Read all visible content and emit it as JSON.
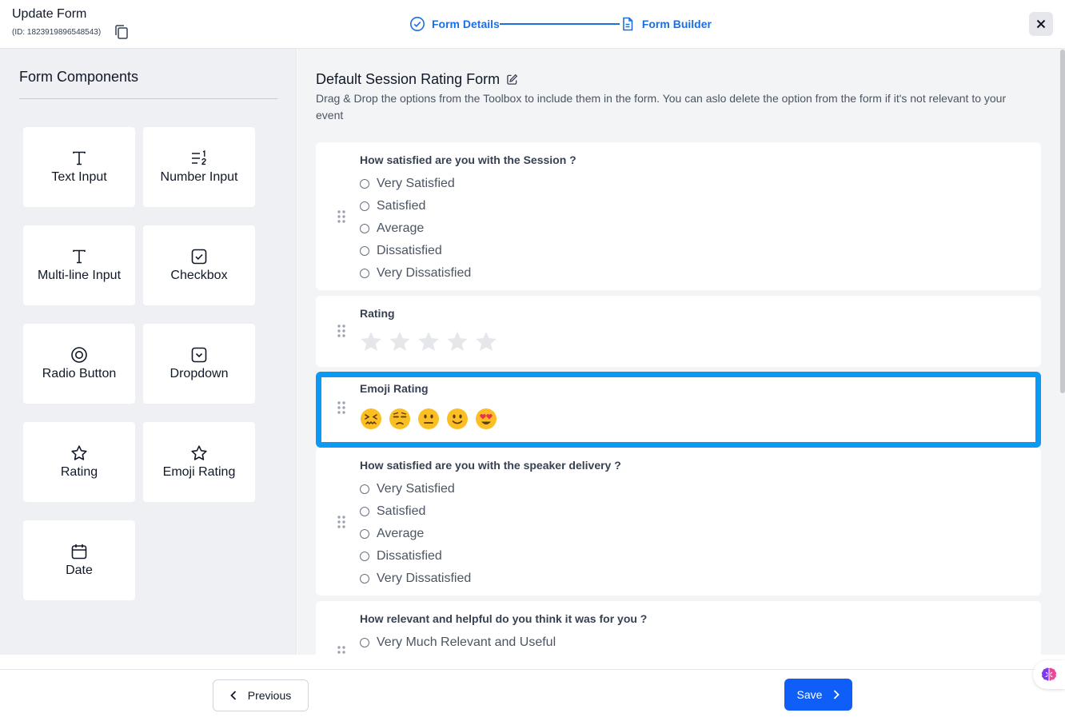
{
  "header": {
    "title": "Update Form",
    "form_id": "(ID: 1823919896548543)",
    "steps": [
      {
        "label": "Form Details",
        "icon": "check-circle-icon"
      },
      {
        "label": "Form Builder",
        "icon": "document-icon"
      }
    ]
  },
  "sidebar": {
    "title": "Form Components",
    "components": [
      {
        "label": "Text Input",
        "icon": "text-icon"
      },
      {
        "label": "Number Input",
        "icon": "number-list-icon"
      },
      {
        "label": "Multi-line Input",
        "icon": "text-icon"
      },
      {
        "label": "Checkbox",
        "icon": "checkbox-icon"
      },
      {
        "label": "Radio Button",
        "icon": "radio-icon"
      },
      {
        "label": "Dropdown",
        "icon": "dropdown-icon"
      },
      {
        "label": "Rating",
        "icon": "star-icon"
      },
      {
        "label": "Emoji Rating",
        "icon": "star-icon"
      },
      {
        "label": "Date",
        "icon": "calendar-icon"
      }
    ]
  },
  "main": {
    "form_title": "Default Session Rating Form",
    "description": "Drag & Drop the options from the Toolbox to include them in the form. You can aslo delete the option from the form if it's not relevant to your event",
    "questions": [
      {
        "label": "How satisfied are you with the Session ?",
        "type": "radio",
        "options": [
          "Very Satisfied",
          "Satisfied",
          "Average",
          "Dissatisfied",
          "Very Dissatisfied"
        ]
      },
      {
        "label": "Rating",
        "type": "rating",
        "max": 5,
        "value": 0
      },
      {
        "label": "Emoji Rating",
        "type": "emoji",
        "emojis": [
          "😖",
          "😒",
          "😐",
          "🙂",
          "😍"
        ]
      },
      {
        "label": "How satisfied are you with the speaker delivery ?",
        "type": "radio",
        "options": [
          "Very Satisfied",
          "Satisfied",
          "Average",
          "Dissatisfied",
          "Very Dissatisfied"
        ]
      },
      {
        "label": "How relevant and helpful do you think it was for you ?",
        "type": "radio",
        "options": [
          "Very Much Relevant and Useful"
        ]
      }
    ]
  },
  "footer": {
    "previous_label": "Previous",
    "save_label": "Save"
  },
  "colors": {
    "accent": "#1d6fe0",
    "save": "#0f5ef7",
    "selected_border": "#0a9af5"
  }
}
